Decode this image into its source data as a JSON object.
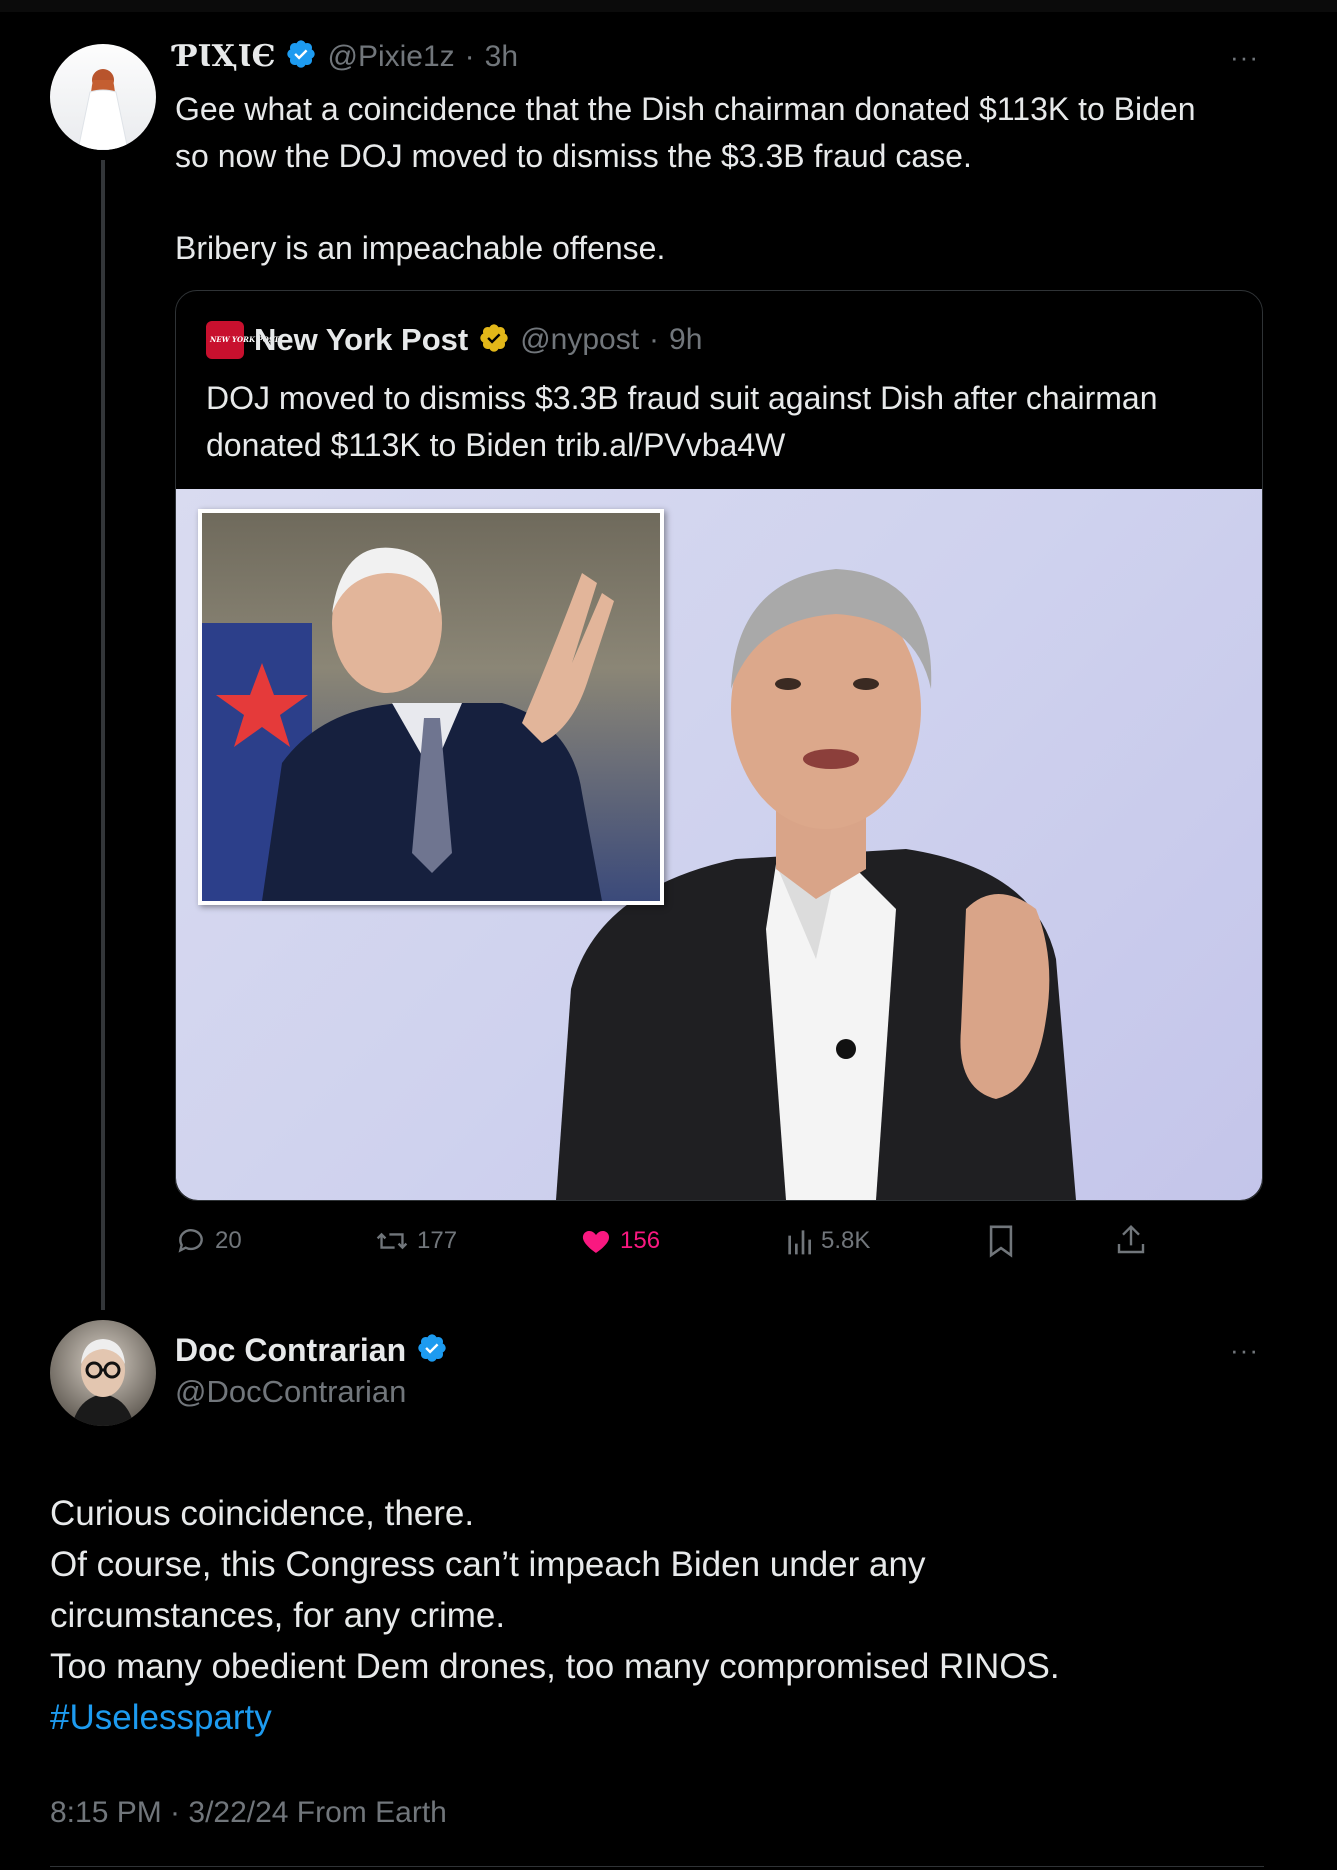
{
  "tweet1": {
    "display_name": "ƤƖҲƖЄ",
    "handle": "@Pixie1z",
    "time": "3h",
    "text_line1": "Gee what a coincidence that the Dish chairman donated $113K to Biden",
    "text_line2": "so now the DOJ moved to dismiss the $3.3B fraud case.",
    "text_line3": "Bribery is an impeachable offense.",
    "more": "···",
    "quote": {
      "display_name": "New York Post",
      "handle": "@nypost",
      "time": "9h",
      "text_line1": "DOJ moved to dismiss $3.3B fraud suit against Dish after chairman",
      "text_line2": "donated $113K to Biden trib.al/PVvba4W",
      "logo_text": "NEW YORK POST"
    },
    "actions": {
      "replies": "20",
      "reposts": "177",
      "likes": "156",
      "views": "5.8K"
    }
  },
  "tweet2": {
    "display_name": "Doc Contrarian",
    "handle": "@DocContrarian",
    "more": "···",
    "line1": "Curious coincidence, there.",
    "line2": "Of course, this Congress can’t impeach Biden under any",
    "line3": "circumstances, for any crime.",
    "line4": "Too many obedient Dem drones, too many compromised RINOS.",
    "hashtag": "#Uselessparty",
    "timestamp": "8:15 PM · 3/22/24 From Earth"
  },
  "colors": {
    "background": "#000000",
    "text": "#e7e9ea",
    "muted": "#71767b",
    "accent": "#1d9bf0",
    "like": "#f91880",
    "gold_badge": "#e2b719"
  }
}
